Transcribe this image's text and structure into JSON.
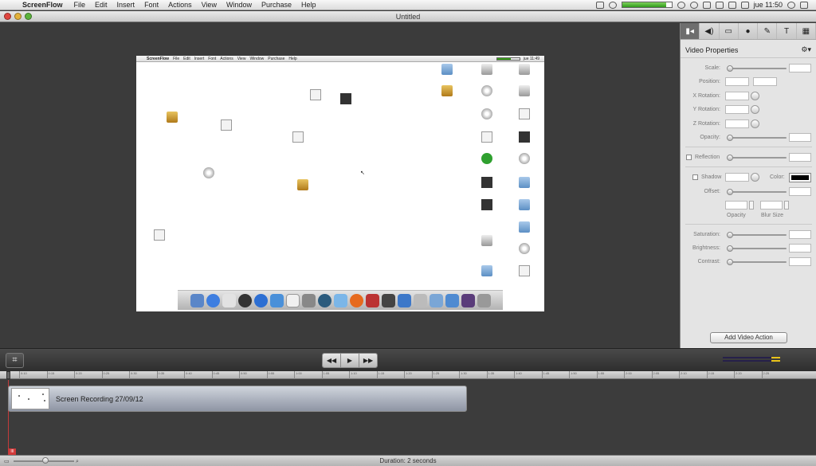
{
  "menubar": {
    "app_name": "ScreenFlow",
    "items": [
      "File",
      "Edit",
      "Insert",
      "Font",
      "Actions",
      "View",
      "Window",
      "Purchase",
      "Help"
    ],
    "clock": "jue 11:50",
    "record_level": 0.9
  },
  "window": {
    "title": "Untitled"
  },
  "preview": {
    "menubar": {
      "app_name": "ScreenFlow",
      "items": [
        "File",
        "Edit",
        "Insert",
        "Font",
        "Actions",
        "View",
        "Window",
        "Purchase",
        "Help"
      ],
      "clock": "jue 11:49"
    }
  },
  "panel": {
    "tabs": [
      {
        "icon": "video-camera-icon",
        "glyph": "▮◂"
      },
      {
        "icon": "speaker-icon",
        "glyph": "◀)"
      },
      {
        "icon": "monitor-icon",
        "glyph": "▭"
      },
      {
        "icon": "record-icon",
        "glyph": "●"
      },
      {
        "icon": "annotate-icon",
        "glyph": "✎"
      },
      {
        "icon": "text-icon",
        "glyph": "T"
      },
      {
        "icon": "grid-icon",
        "glyph": "▦"
      }
    ],
    "title": "Video Properties",
    "gear_glyph": "⚙▾",
    "labels": {
      "scale": "Scale:",
      "position": "Position:",
      "x_rotation": "X Rotation:",
      "y_rotation": "Y Rotation:",
      "z_rotation": "Z Rotation:",
      "opacity": "Opacity:",
      "reflection": "Reflection",
      "shadow": "Shadow",
      "color": "Color:",
      "offset": "Offset:",
      "opacity_small": "Opacity",
      "blur_size": "Blur Size",
      "saturation": "Saturation:",
      "brightness": "Brightness:",
      "contrast": "Contrast:"
    },
    "shadow_color": "#000000",
    "add_action_label": "Add Video Action"
  },
  "controls": {
    "crop_glyph": "⌗",
    "rewind_glyph": "◀◀",
    "play_glyph": "▶",
    "forward_glyph": "▶▶"
  },
  "timeline": {
    "ruler_ticks": [
      "0:10",
      "0:15",
      "0:20",
      "0:25",
      "0:30",
      "0:35",
      "0:40",
      "0:45",
      "0:50",
      "0:55",
      "1:00",
      "1:05",
      "1:10",
      "1:15",
      "1:20",
      "1:25",
      "1:30",
      "1:35",
      "1:40",
      "1:45",
      "1:50",
      "1:55",
      "2:00",
      "2:05",
      "2:10",
      "2:15",
      "2:20",
      "2:25"
    ],
    "clip_title": "Screen Recording 27/09/12",
    "marker_label": "III"
  },
  "status": {
    "duration": "Duration: 2 seconds"
  }
}
